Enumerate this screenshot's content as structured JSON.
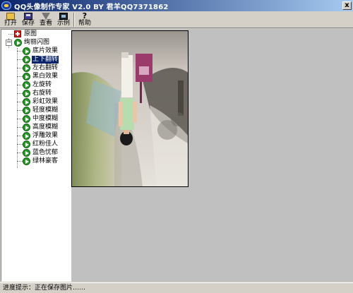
{
  "window": {
    "title": "QQ头像制作专家 V2.0 BY 君羊QQ7371862",
    "close_glyph": "x"
  },
  "toolbar": {
    "buttons": [
      {
        "label": "打开",
        "icon": "folder-icon"
      },
      {
        "label": "保存",
        "icon": "floppy-icon"
      },
      {
        "label": "查看",
        "icon": "funnel-icon"
      },
      {
        "label": "示例",
        "icon": "film-icon"
      },
      {
        "label": "帮助",
        "icon": "help-icon"
      }
    ],
    "help_glyph": "?"
  },
  "tree": {
    "root_label": "原图",
    "group_label": "绚丽闪图",
    "expander_glyph": "−",
    "items": [
      {
        "label": "底片效果",
        "selected": false
      },
      {
        "label": "上下翻转",
        "selected": true
      },
      {
        "label": "左右翻转",
        "selected": false
      },
      {
        "label": "黑白效果",
        "selected": false
      },
      {
        "label": "左旋转",
        "selected": false
      },
      {
        "label": "右旋转",
        "selected": false
      },
      {
        "label": "彩虹效果",
        "selected": false
      },
      {
        "label": "轻度模糊",
        "selected": false
      },
      {
        "label": "中度模糊",
        "selected": false
      },
      {
        "label": "高度模糊",
        "selected": false
      },
      {
        "label": "浮雕效果",
        "selected": false
      },
      {
        "label": "红粉佳人",
        "selected": false
      },
      {
        "label": "蓝色忧郁",
        "selected": false
      },
      {
        "label": "绿林豪客",
        "selected": false
      }
    ]
  },
  "status": {
    "text": "进度提示：正在保存图片……"
  },
  "colors": {
    "selection": "#0a246a",
    "tree_icon": "#2a9a2a",
    "root_icon": "#d02020"
  }
}
